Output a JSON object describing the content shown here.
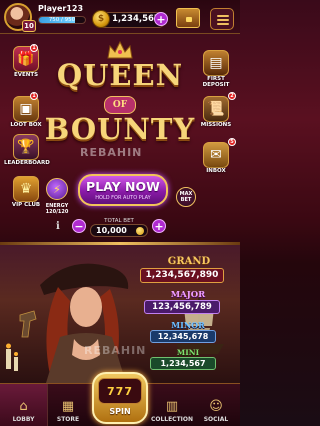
{
  "player": {
    "name": "Player123",
    "level": "10",
    "xp_text": "750 / 950",
    "xp_progress": 0.79
  },
  "currency": {
    "coins": "1,234,567"
  },
  "side_left": [
    {
      "label": "EVENTS",
      "icon": "gift-icon",
      "badge": "1"
    },
    {
      "label": "LOOT BOX",
      "icon": "loot-box-icon",
      "badge": "1"
    },
    {
      "label": "LEADERBOARD",
      "icon": "trophy-icon",
      "badge": ""
    },
    {
      "label": "VIP CLUB",
      "icon": "crown-icon",
      "badge": ""
    }
  ],
  "side_right": [
    {
      "label": "FIRST DEPOSIT",
      "icon": "treasure-chest-icon",
      "badge": ""
    },
    {
      "label": "MISSIONS",
      "icon": "scroll-icon",
      "badge": "2"
    },
    {
      "label": "INBOX",
      "icon": "envelope-icon",
      "badge": "5"
    }
  ],
  "logo": {
    "line1": "QUEEN",
    "line2": "OF",
    "line3": "BOUNTY"
  },
  "watermark": "REBAHIN",
  "energy": {
    "label": "ENERGY",
    "value": "120/120"
  },
  "play": {
    "label": "PLAY NOW",
    "sub": "HOLD FOR AUTO PLAY"
  },
  "max_bet": {
    "line1": "MAX",
    "line2": "BET"
  },
  "bet": {
    "label": "TOTAL BET",
    "value": "10,000"
  },
  "jackpots": {
    "grand": {
      "label": "GRAND",
      "value": "1,234,567,890"
    },
    "major": {
      "label": "MAJOR",
      "value": "123,456,789"
    },
    "minor": {
      "label": "MINOR",
      "value": "12,345,678"
    },
    "mini": {
      "label": "MINI",
      "value": "1,234,567"
    }
  },
  "nav": {
    "lobby": "LOBBY",
    "store": "STORE",
    "spin": "SPIN",
    "spin_reels": "777",
    "collection": "COLLECTION",
    "social": "SOCIAL"
  },
  "colors": {
    "accent": "#b02ad0",
    "gold": "#f7d57a",
    "background": "#3a0812"
  }
}
